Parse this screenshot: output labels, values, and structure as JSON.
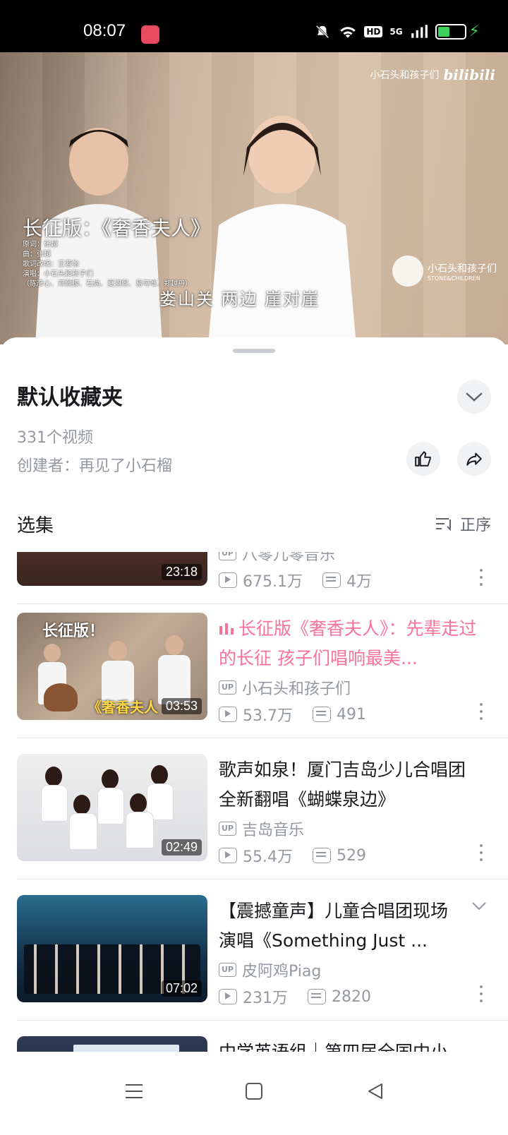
{
  "status_bar": {
    "time": "08:07",
    "network": "5G",
    "hd": "HD"
  },
  "video": {
    "watermark_channel": "小石头和孩子们",
    "watermark_brand": "bilibili",
    "title_overlay": "长征版：《奢香夫人》",
    "credits": [
      "原词：张超",
      "曲：张超",
      "歌词改编：王若怡",
      "演唱：小石头和孩子们",
      "（陈彦心、邓熙朦、石尚、夏羽熙、易可唯、郑越丹）"
    ],
    "subtitle": "娄山关  两边  崖对崖",
    "logo_name": "小石头和孩子们",
    "logo_sub": "STONE&CHILDREN"
  },
  "panel": {
    "title": "默认收藏夹",
    "count": "331个视频",
    "creator": "创建者：再见了小石榴",
    "section_label": "选集",
    "sort_label": "正序"
  },
  "items": [
    {
      "title": "",
      "up": "八零儿零音乐",
      "views": "675.1万",
      "danmaku": "4万",
      "duration": "23:18",
      "active": false
    },
    {
      "title": "长征版《奢香夫人》：先辈走过的长征 孩子们唱响最美...",
      "up": "小石头和孩子们",
      "views": "53.7万",
      "danmaku": "491",
      "duration": "03:53",
      "active": true,
      "thumb_tag": "长征版！",
      "thumb_tag2": "《奢香夫人"
    },
    {
      "title": "歌声如泉！厦门吉岛少儿合唱团全新翻唱《蝴蝶泉边》",
      "up": "吉岛音乐",
      "views": "55.4万",
      "danmaku": "529",
      "duration": "02:49",
      "active": false
    },
    {
      "title": "【震撼童声】儿童合唱团现场演唱《Something Just ...",
      "up": "皮阿鸡Piag",
      "views": "231万",
      "danmaku": "2820",
      "duration": "07:02",
      "active": false
    },
    {
      "title": "中学英语组｜第四届全国中小",
      "up": "",
      "views": "",
      "danmaku": "",
      "duration": "",
      "active": false
    }
  ],
  "up_badge": "UP",
  "colors": {
    "accent": "#fb7299",
    "muted": "#9499a0",
    "text": "#18191c"
  }
}
